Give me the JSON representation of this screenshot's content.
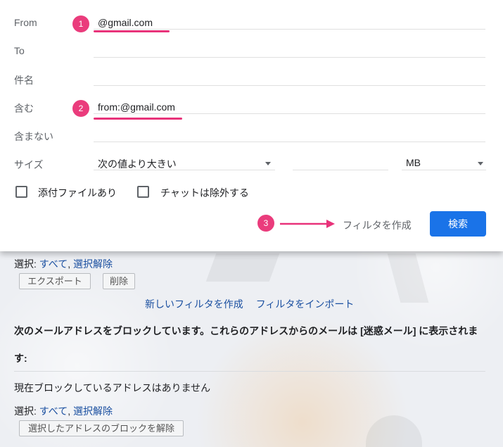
{
  "filter_panel": {
    "rows": [
      {
        "label": "From",
        "value": "@gmail.com"
      },
      {
        "label": "To",
        "value": ""
      },
      {
        "label": "件名",
        "value": ""
      },
      {
        "label": "含む",
        "value": "from:@gmail.com"
      },
      {
        "label": "含まない",
        "value": ""
      }
    ],
    "size": {
      "label": "サイズ",
      "comparison": "次の値より大きい",
      "value": "",
      "unit": "MB"
    },
    "checkboxes": [
      {
        "label": "添付ファイルあり",
        "checked": false
      },
      {
        "label": "チャットは除外する",
        "checked": false
      }
    ],
    "create_filter_label": "フィルタを作成",
    "search_button_label": "検索",
    "badges": [
      "1",
      "2",
      "3"
    ],
    "accent_color": "#e8337a",
    "button_color": "#1a73e8"
  },
  "filters_section": {
    "select_prefix": "選択: ",
    "select_all": "すべて",
    "select_sep": ", ",
    "deselect": "選択解除",
    "export_button": "エクスポート",
    "delete_button": "削除",
    "new_filter_link": "新しいフィルタを作成",
    "import_filter_link": "フィルタをインポート"
  },
  "blocked_section": {
    "heading_line1": "次のメールアドレスをブロックしています。これらのアドレスからのメールは [迷惑メール] に表示されま",
    "heading_line2": "す:",
    "empty_message": "現在ブロックしているアドレスはありません",
    "select_prefix": "選択: ",
    "select_all": "すべて",
    "select_sep": ", ",
    "deselect": "選択解除",
    "unblock_button": "選択したアドレスのブロックを解除"
  }
}
